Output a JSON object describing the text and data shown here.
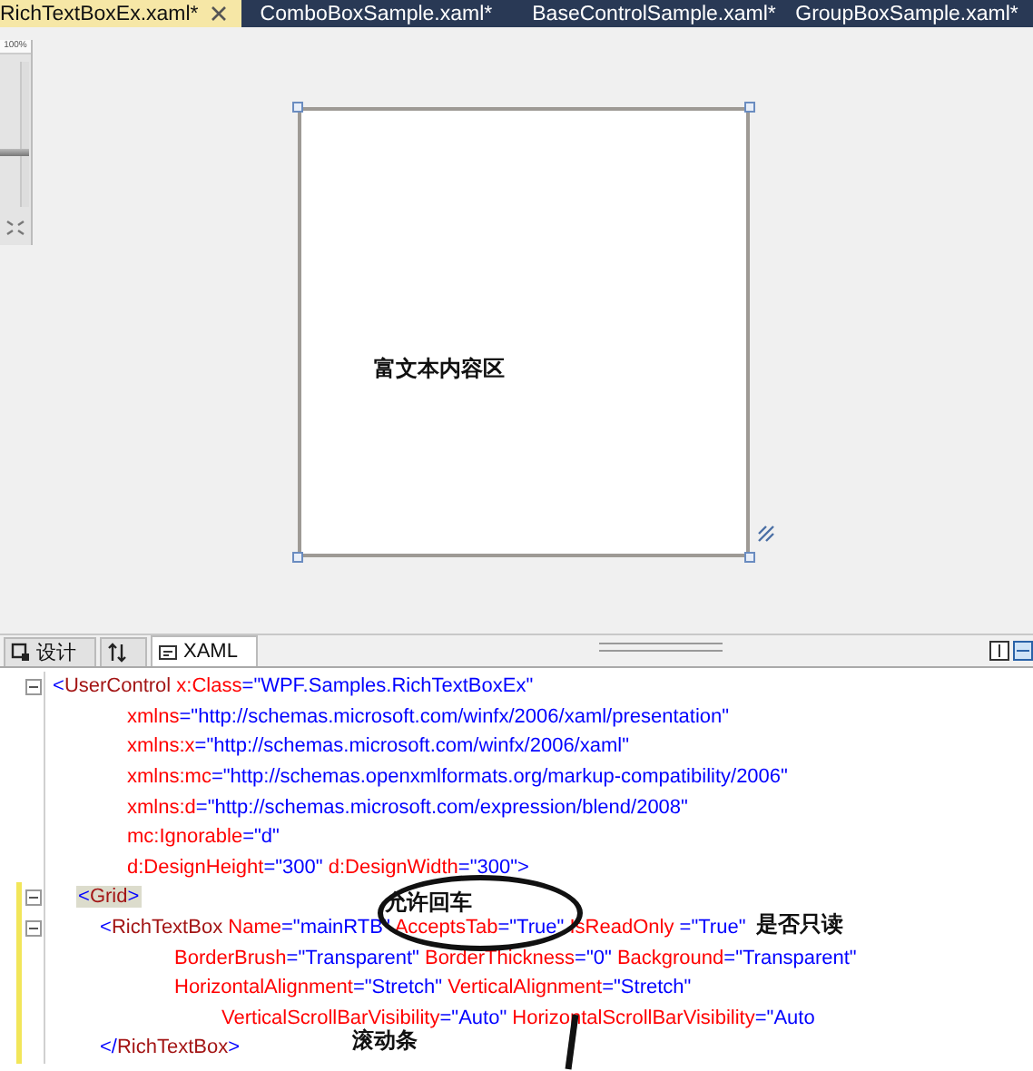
{
  "editor_tabs": [
    {
      "label": "RichTextBoxEx.xaml*",
      "selected": true
    },
    {
      "label": "ComboBoxSample.xaml*",
      "selected": false
    },
    {
      "label": "BaseControlSample.xaml*",
      "selected": false
    },
    {
      "label": "GroupBoxSample.xaml*",
      "selected": false
    }
  ],
  "designer": {
    "zoom": {
      "label": "100%",
      "level": 0.35
    },
    "rich_text_box": {
      "text": "富文本内容区"
    }
  },
  "view_tabs": [
    {
      "kind": "design",
      "label": "设计",
      "selected": false
    },
    {
      "kind": "swap",
      "selected": false
    },
    {
      "kind": "xaml",
      "label": "XAML",
      "selected": true
    }
  ],
  "code": [
    {
      "expanded": true,
      "changed": false,
      "tokens": [
        {
          "kind": "b",
          "text": "<"
        },
        {
          "kind": "tag",
          "text": "UserControl"
        },
        {
          "kind": "attr",
          "text": " x:Class"
        },
        {
          "kind": "b",
          "text": "="
        },
        {
          "kind": "val",
          "text": "\"WPF.Samples.RichTextBoxEx\""
        }
      ],
      "continued": [
        {
          "changed": false,
          "tokens": [
            {
              "kind": "attr",
              "text": "xmlns"
            },
            {
              "kind": "b",
              "text": "="
            },
            {
              "kind": "val",
              "text": "\"http://schemas.microsoft.com/winfx/2006/xaml/presentation\""
            }
          ]
        },
        {
          "changed": false,
          "tokens": [
            {
              "kind": "attr",
              "text": "xmlns:x"
            },
            {
              "kind": "b",
              "text": "="
            },
            {
              "kind": "val",
              "text": "\"http://schemas.microsoft.com/winfx/2006/xaml\""
            }
          ]
        },
        {
          "changed": false,
          "tokens": [
            {
              "kind": "attr",
              "text": "xmlns:mc"
            },
            {
              "kind": "b",
              "text": "="
            },
            {
              "kind": "val",
              "text": "\"http://schemas.openxmlformats.org/markup-compatibility/2006\""
            }
          ]
        },
        {
          "changed": false,
          "tokens": [
            {
              "kind": "attr",
              "text": "xmlns:d"
            },
            {
              "kind": "b",
              "text": "="
            },
            {
              "kind": "val",
              "text": "\"http://schemas.microsoft.com/expression/blend/2008\""
            }
          ]
        },
        {
          "changed": false,
          "tokens": [
            {
              "kind": "attr",
              "text": "mc:Ignorable"
            },
            {
              "kind": "b",
              "text": "="
            },
            {
              "kind": "val",
              "text": "\"d\""
            }
          ]
        },
        {
          "changed": false,
          "tokens": [
            {
              "kind": "attr",
              "text": "d:DesignHeight"
            },
            {
              "kind": "b",
              "text": "="
            },
            {
              "kind": "val",
              "text": "\"300\""
            },
            {
              "kind": "attr",
              "text": " d:DesignWidth"
            },
            {
              "kind": "b",
              "text": "="
            },
            {
              "kind": "val",
              "text": "\"300\""
            },
            {
              "kind": "b",
              "text": ">"
            }
          ]
        }
      ],
      "children": [
        {
          "expanded": true,
          "changed": true,
          "highlighted": true,
          "tokens": [
            {
              "kind": "b",
              "text": "<"
            },
            {
              "kind": "tag",
              "text": "Grid"
            },
            {
              "kind": "b",
              "text": ">"
            }
          ],
          "children": [
            {
              "expanded": true,
              "changed": true,
              "tokens": [
                {
                  "kind": "b",
                  "text": "<"
                },
                {
                  "kind": "tag",
                  "text": "RichTextBox"
                },
                {
                  "kind": "attr",
                  "text": " Name"
                },
                {
                  "kind": "b",
                  "text": "="
                },
                {
                  "kind": "val",
                  "text": "\"mainRTB\""
                },
                {
                  "kind": "attr",
                  "text": " AcceptsTab"
                },
                {
                  "kind": "b",
                  "text": "="
                },
                {
                  "kind": "val",
                  "text": "\"True\""
                },
                {
                  "kind": "attr",
                  "text": " IsReadOnly "
                },
                {
                  "kind": "b",
                  "text": "="
                },
                {
                  "kind": "val",
                  "text": "\"True\""
                }
              ],
              "note": {
                "kind": "inline",
                "text": "是否只读"
              },
              "continued": [
                {
                  "changed": true,
                  "tokens": [
                    {
                      "kind": "attr",
                      "text": "BorderBrush"
                    },
                    {
                      "kind": "b",
                      "text": "="
                    },
                    {
                      "kind": "val",
                      "text": "\"Transparent\""
                    },
                    {
                      "kind": "attr",
                      "text": " BorderThickness"
                    },
                    {
                      "kind": "b",
                      "text": "="
                    },
                    {
                      "kind": "val",
                      "text": "\"0\""
                    },
                    {
                      "kind": "attr",
                      "text": " Background"
                    },
                    {
                      "kind": "b",
                      "text": "="
                    },
                    {
                      "kind": "val",
                      "text": "\"Transparent\""
                    }
                  ]
                },
                {
                  "changed": true,
                  "tokens": [
                    {
                      "kind": "attr",
                      "text": "HorizontalAlignment"
                    },
                    {
                      "kind": "b",
                      "text": "="
                    },
                    {
                      "kind": "val",
                      "text": "\"Stretch\""
                    },
                    {
                      "kind": "attr",
                      "text": " VerticalAlignment"
                    },
                    {
                      "kind": "b",
                      "text": "="
                    },
                    {
                      "kind": "val",
                      "text": "\"Stretch\""
                    }
                  ],
                  "continued": [
                    {
                      "changed": true,
                      "tokens": [
                        {
                          "kind": "attr",
                          "text": "VerticalScrollBarVisibility"
                        },
                        {
                          "kind": "b",
                          "text": "="
                        },
                        {
                          "kind": "val",
                          "text": "\"Auto\""
                        },
                        {
                          "kind": "attr",
                          "text": " HorizontalScrollBarVisibility"
                        },
                        {
                          "kind": "b",
                          "text": "="
                        },
                        {
                          "kind": "val",
                          "text": "\"Auto"
                        }
                      ]
                    }
                  ]
                }
              ]
            },
            {
              "changed": true,
              "tokens": [
                {
                  "kind": "b",
                  "text": "</"
                },
                {
                  "kind": "tag",
                  "text": "RichTextBox"
                },
                {
                  "kind": "b",
                  "text": ">"
                }
              ],
              "note": {
                "kind": "below",
                "text": "滚动条"
              }
            }
          ]
        }
      ]
    }
  ],
  "annotations": [
    {
      "kind": "ellipse",
      "text": "允许回车"
    },
    {
      "kind": "stroke"
    }
  ]
}
